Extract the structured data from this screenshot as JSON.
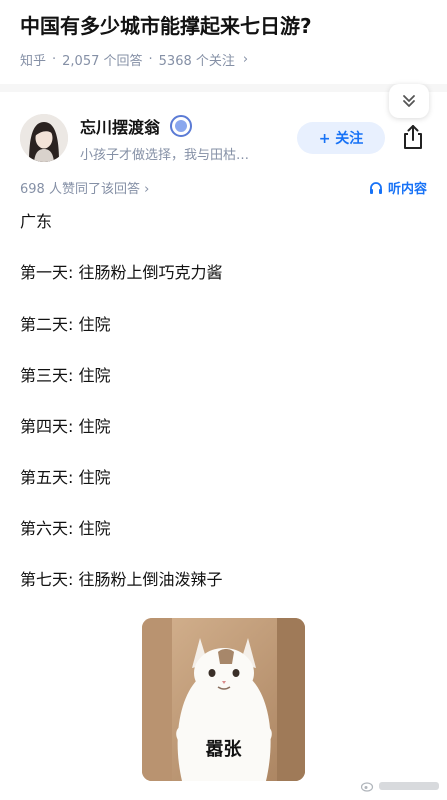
{
  "question": {
    "title": "中国有多少城市能撑起来七日游?",
    "source": "知乎",
    "answers": "2,057 个回答",
    "followers": "5368 个关注"
  },
  "author": {
    "name": "忘川摆渡翁",
    "bio": "小孩子才做选择，我与田枯…",
    "follow_label": "+ 关注"
  },
  "answer": {
    "upvotes": "698 人赞同了该回答",
    "listen_label": "听内容",
    "lines": [
      "广东",
      "第一天: 往肠粉上倒巧克力酱",
      "第二天: 住院",
      "第三天: 住院",
      "第四天: 住院",
      "第五天: 住院",
      "第六天: 住院",
      "第七天: 往肠粉上倒油泼辣子"
    ],
    "meme_caption": "嚣张"
  },
  "icons": {
    "collapse": "double-chevron-down-icon",
    "verified": "verified-badge-icon",
    "share": "share-icon",
    "listen": "headphones-icon"
  },
  "colors": {
    "accent": "#1772f6",
    "meta": "#8590a6",
    "follow_bg": "#e8f0fe"
  }
}
